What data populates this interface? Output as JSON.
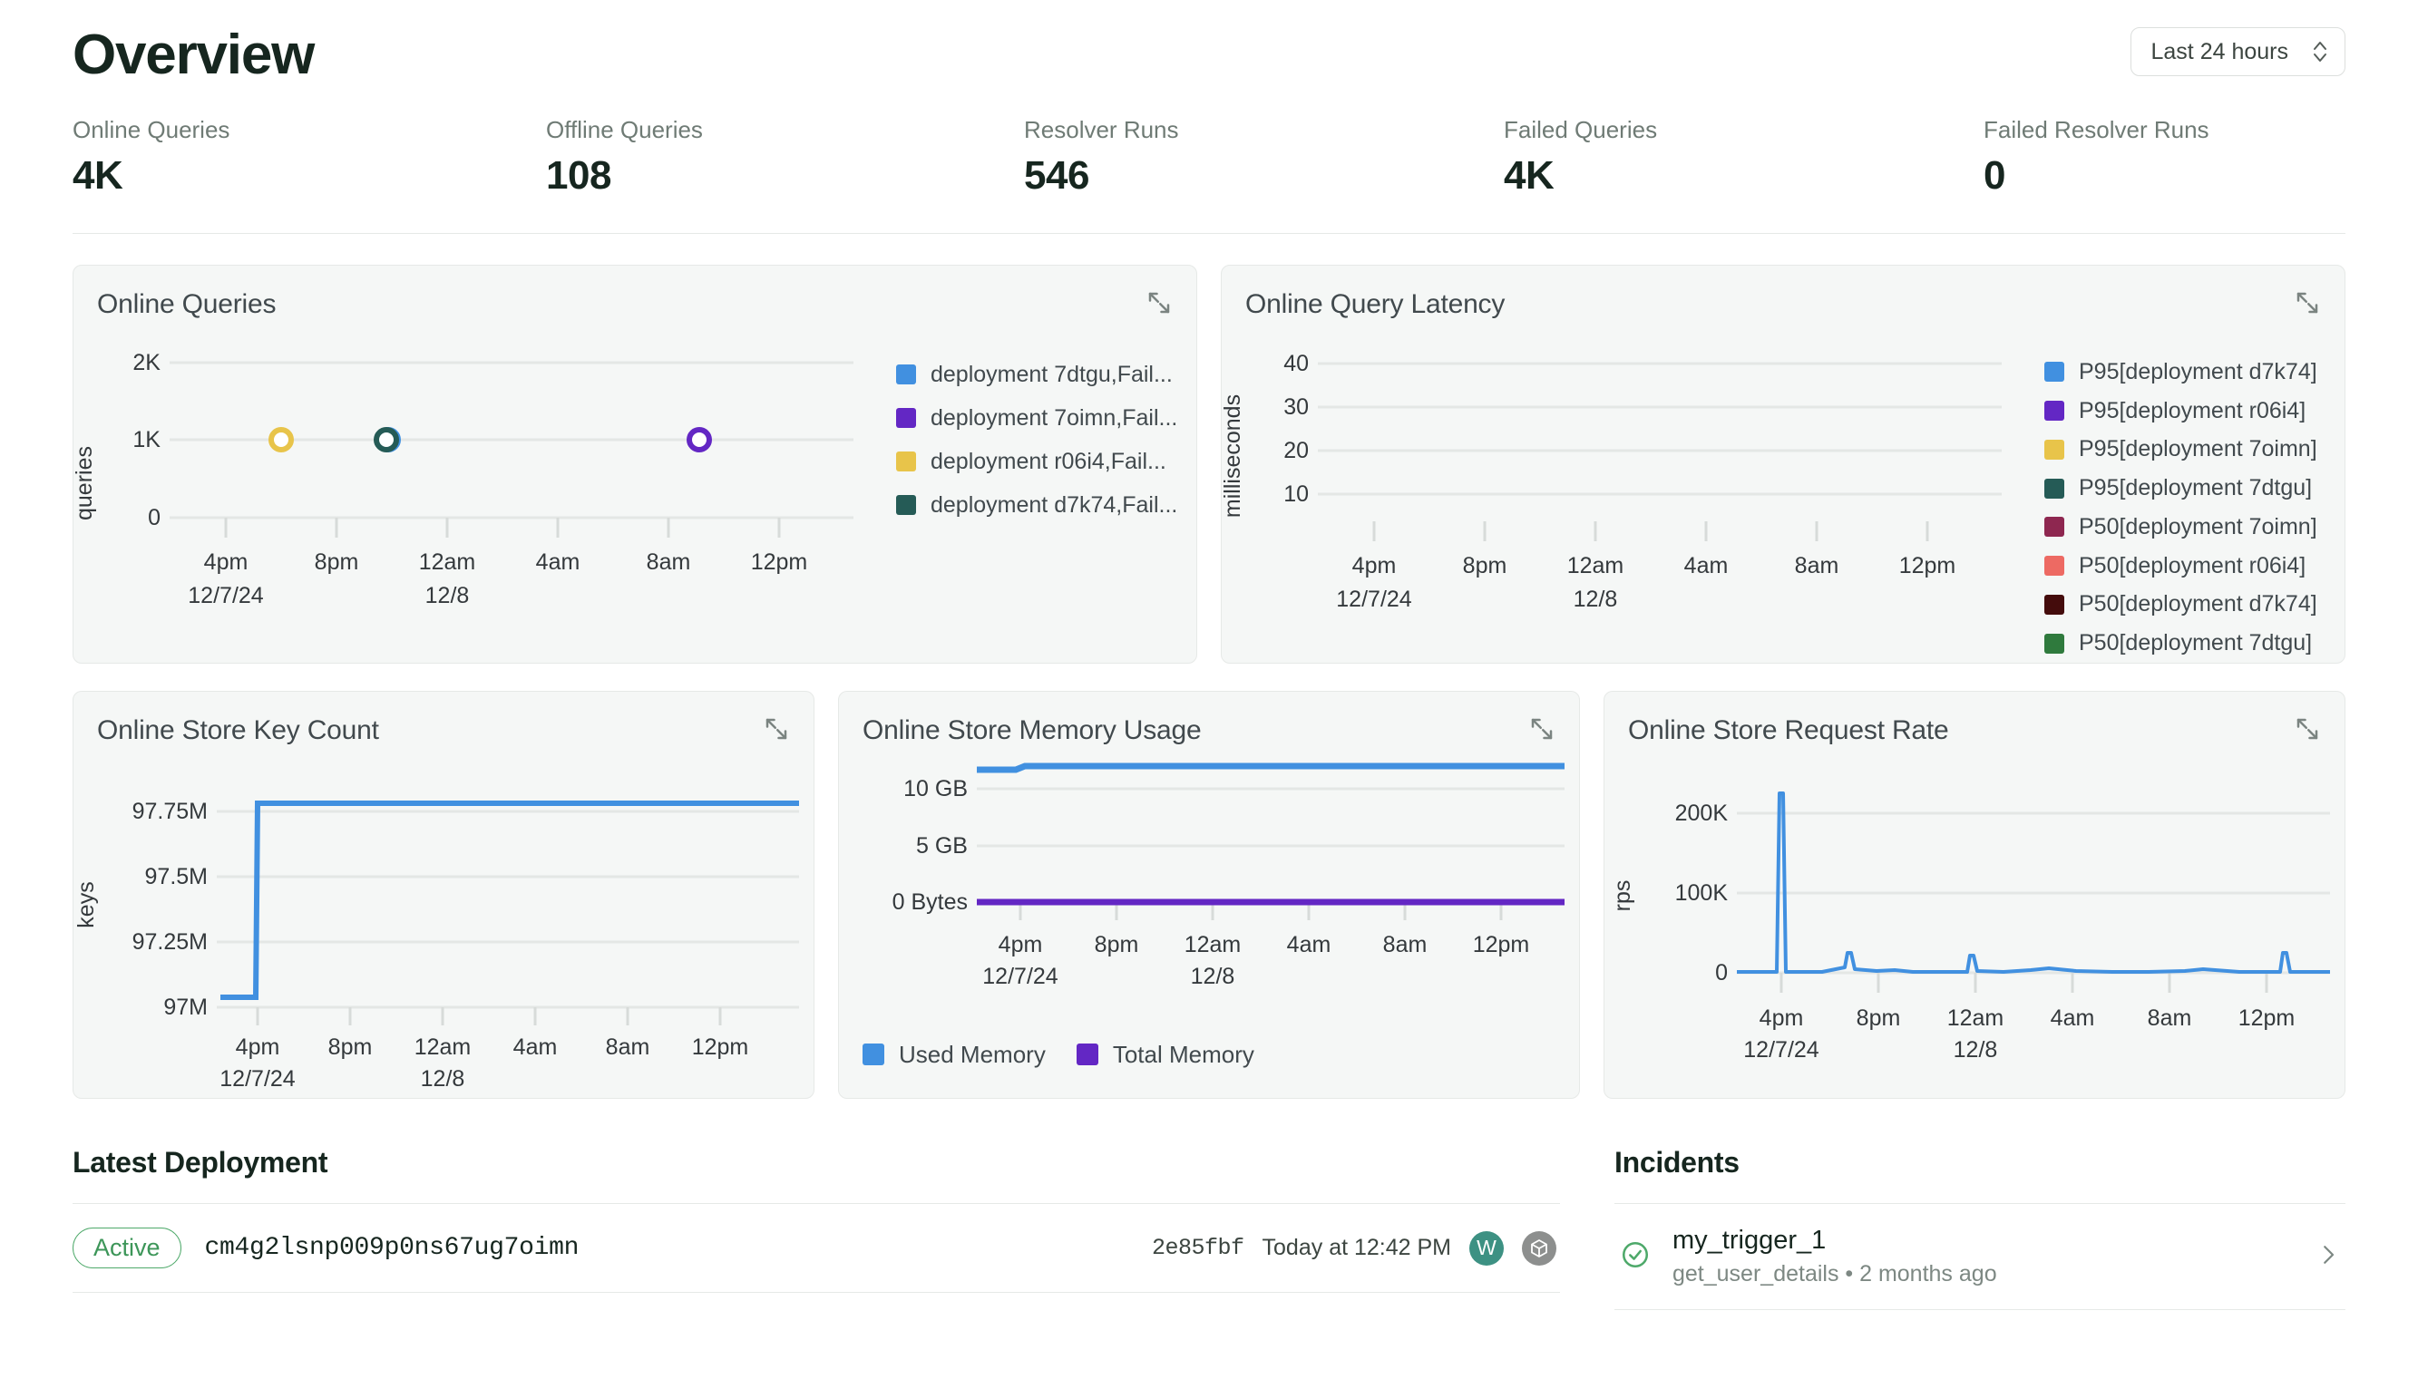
{
  "header": {
    "title": "Overview",
    "time_range": {
      "value": "Last 24 hours",
      "icon": "chevron-up-down-icon"
    }
  },
  "stats": [
    {
      "label": "Online Queries",
      "value": "4K"
    },
    {
      "label": "Offline Queries",
      "value": "108"
    },
    {
      "label": "Resolver Runs",
      "value": "546"
    },
    {
      "label": "Failed Queries",
      "value": "4K"
    },
    {
      "label": "Failed Resolver Runs",
      "value": "0"
    }
  ],
  "panels": {
    "online_queries": {
      "title": "Online Queries",
      "expand_icon": "expand-diagonal-icon"
    },
    "latency": {
      "title": "Online Query Latency",
      "expand_icon": "expand-diagonal-icon"
    },
    "key_count": {
      "title": "Online Store Key Count",
      "expand_icon": "expand-diagonal-icon"
    },
    "memory": {
      "title": "Online Store Memory Usage",
      "expand_icon": "expand-diagonal-icon"
    },
    "request_rate": {
      "title": "Online Store Request Rate",
      "expand_icon": "expand-diagonal-icon"
    }
  },
  "chart_data": [
    {
      "id": "online_queries",
      "type": "scatter",
      "title": "Online Queries",
      "xlabel": "",
      "ylabel": "queries",
      "ylim": [
        0,
        2000
      ],
      "yticks": [
        "0",
        "1K",
        "2K"
      ],
      "xticks": [
        "4pm",
        "8pm",
        "12am",
        "4am",
        "8am",
        "12pm"
      ],
      "xtick_sublabels": [
        "12/7/24",
        "",
        "12/8",
        "",
        "",
        ""
      ],
      "grid": true,
      "legend_position": "right",
      "series": [
        {
          "name": "deployment 7dtgu,Fail...",
          "color": "#4190e0",
          "points": [
            {
              "x": "10pm",
              "y": 1000
            }
          ]
        },
        {
          "name": "deployment 7oimn,Fail...",
          "color": "#6327c4",
          "points": [
            {
              "x": "12pm",
              "y": 1000
            }
          ]
        },
        {
          "name": "deployment r06i4,Fail...",
          "color": "#e8c44a",
          "points": [
            {
              "x": "6pm",
              "y": 1000
            }
          ]
        },
        {
          "name": "deployment d7k74,Fail...",
          "color": "#255b56",
          "points": [
            {
              "x": "10pm",
              "y": 1000
            }
          ]
        }
      ]
    },
    {
      "id": "online_query_latency",
      "type": "line",
      "title": "Online Query Latency",
      "xlabel": "",
      "ylabel": "milliseconds",
      "ylim": [
        5,
        45
      ],
      "yticks": [
        "10",
        "20",
        "30",
        "40"
      ],
      "xticks": [
        "4pm",
        "8pm",
        "12am",
        "4am",
        "8am",
        "12pm"
      ],
      "xtick_sublabels": [
        "12/7/24",
        "",
        "12/8",
        "",
        "",
        ""
      ],
      "grid": true,
      "legend_position": "right",
      "series": [
        {
          "name": "P95[deployment d7k74]",
          "color": "#4190e0",
          "values": []
        },
        {
          "name": "P95[deployment r06i4]",
          "color": "#6327c4",
          "values": []
        },
        {
          "name": "P95[deployment 7oimn]",
          "color": "#e8c44a",
          "values": []
        },
        {
          "name": "P95[deployment 7dtgu]",
          "color": "#255b56",
          "values": []
        },
        {
          "name": "P50[deployment 7oimn]",
          "color": "#8e2750",
          "values": []
        },
        {
          "name": "P50[deployment r06i4]",
          "color": "#ed6a63",
          "values": []
        },
        {
          "name": "P50[deployment d7k74]",
          "color": "#440c0c",
          "values": []
        },
        {
          "name": "P50[deployment 7dtgu]",
          "color": "#2f7a3d",
          "values": []
        }
      ]
    },
    {
      "id": "online_store_key_count",
      "type": "line",
      "title": "Online Store Key Count",
      "xlabel": "",
      "ylabel": "keys",
      "ylim": [
        97000000,
        97900000
      ],
      "yticks": [
        "97M",
        "97.25M",
        "97.5M",
        "97.75M"
      ],
      "xticks": [
        "4pm",
        "8pm",
        "12am",
        "4am",
        "8am",
        "12pm"
      ],
      "xtick_sublabels": [
        "12/7/24",
        "",
        "12/8",
        "",
        "",
        ""
      ],
      "grid": true,
      "series": [
        {
          "name": "keys",
          "color": "#4190e0",
          "values": [
            97120000,
            97120000,
            97800000,
            97800000,
            97800000,
            97800000,
            97800000,
            97800000,
            97800000
          ]
        }
      ]
    },
    {
      "id": "online_store_memory_usage",
      "type": "line",
      "title": "Online Store Memory Usage",
      "xlabel": "",
      "ylabel": "",
      "ylim": [
        0,
        13000000000
      ],
      "yticks": [
        "0 Bytes",
        "5 GB",
        "10 GB"
      ],
      "xticks": [
        "4pm",
        "8pm",
        "12am",
        "4am",
        "8am",
        "12pm"
      ],
      "xtick_sublabels": [
        "12/7/24",
        "",
        "12/8",
        "",
        "",
        ""
      ],
      "grid": true,
      "legend_position": "bottom",
      "series": [
        {
          "name": "Used Memory",
          "color": "#4190e0",
          "values": [
            11500000000,
            11600000000,
            11650000000,
            11650000000,
            11650000000,
            11650000000,
            11650000000,
            11650000000,
            11650000000
          ]
        },
        {
          "name": "Total Memory",
          "color": "#6327c4",
          "values": [
            0,
            0,
            0,
            0,
            0,
            0,
            0,
            0,
            0
          ]
        }
      ]
    },
    {
      "id": "online_store_request_rate",
      "type": "line",
      "title": "Online Store Request Rate",
      "xlabel": "",
      "ylabel": "rps",
      "ylim": [
        0,
        240000
      ],
      "yticks": [
        "0",
        "100K",
        "200K"
      ],
      "xticks": [
        "4pm",
        "8pm",
        "12am",
        "4am",
        "8am",
        "12pm"
      ],
      "xtick_sublabels": [
        "12/7/24",
        "",
        "12/8",
        "",
        "",
        ""
      ],
      "grid": true,
      "series": [
        {
          "name": "rps",
          "color": "#4190e0",
          "spikes": [
            {
              "x_frac": 0.075,
              "value": 225000
            },
            {
              "x_frac": 0.185,
              "value": 28000
            },
            {
              "x_frac": 0.395,
              "value": 25000
            },
            {
              "x_frac": 0.58,
              "value": 5000
            },
            {
              "x_frac": 0.79,
              "value": 3000
            },
            {
              "x_frac": 0.945,
              "value": 27000
            }
          ]
        }
      ]
    }
  ],
  "latest_deployment": {
    "section_title": "Latest Deployment",
    "status": "Active",
    "id": "cm4g2lsnp009p0ns67ug7oimn",
    "commit": "2e85fbf",
    "timestamp": "Today at 12:42 PM",
    "avatar_initial": "W",
    "package_icon": "cube-icon"
  },
  "incidents": {
    "section_title": "Incidents",
    "items": [
      {
        "status_icon": "check-circle-icon",
        "title": "my_trigger_1",
        "subtitle": "get_user_details • 2 months ago",
        "arrow_icon": "chevron-right-icon"
      }
    ]
  }
}
